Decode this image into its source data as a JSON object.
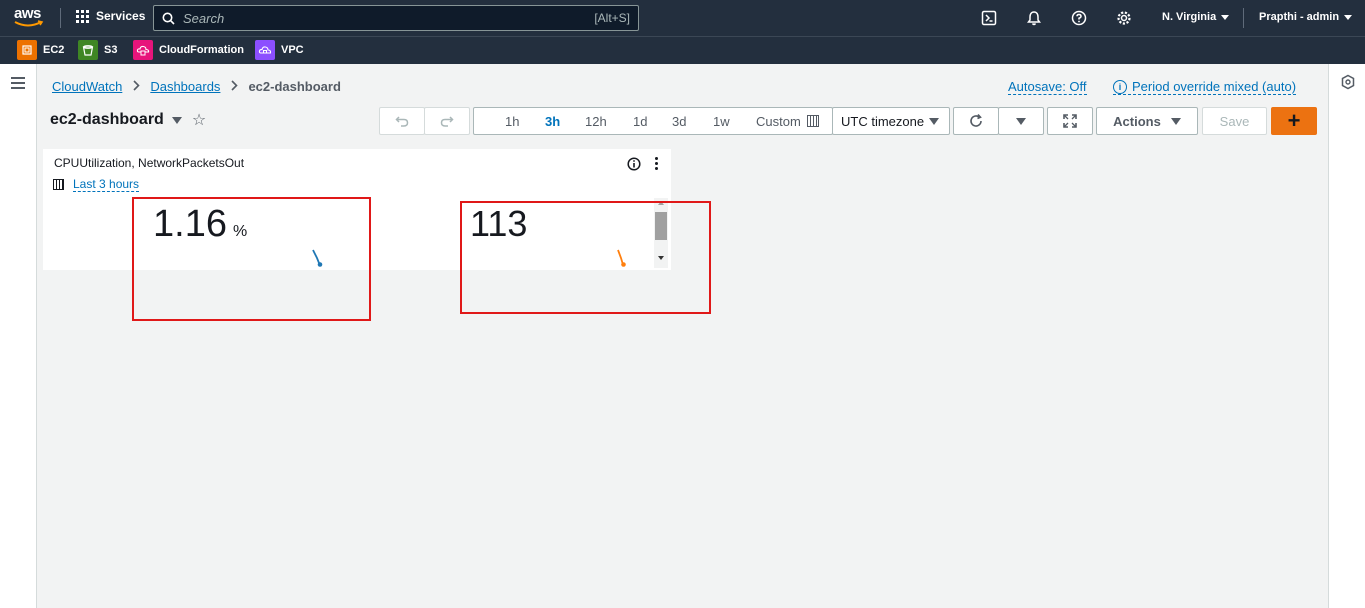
{
  "topnav": {
    "logo_text": "aws",
    "services_label": "Services",
    "search_placeholder": "Search",
    "search_shortcut": "[Alt+S]",
    "region": "N. Virginia",
    "user": "Prapthi - admin"
  },
  "favorites": [
    {
      "label": "EC2",
      "color": "#ed7100"
    },
    {
      "label": "S3",
      "color": "#3f8624"
    },
    {
      "label": "CloudFormation",
      "color": "#e7157b"
    },
    {
      "label": "VPC",
      "color": "#8c4fff"
    }
  ],
  "breadcrumb": {
    "items": [
      "CloudWatch",
      "Dashboards",
      "ec2-dashboard"
    ]
  },
  "header": {
    "autosave": "Autosave: Off",
    "period_override": "Period override mixed (auto)",
    "dashboard_title": "ec2-dashboard"
  },
  "toolbar": {
    "time_ranges": [
      "1h",
      "3h",
      "12h",
      "1d",
      "3d",
      "1w"
    ],
    "selected_range": "3h",
    "custom_label": "Custom",
    "timezone": "UTC timezone",
    "actions_label": "Actions",
    "save_label": "Save",
    "add_label": "+"
  },
  "widget": {
    "title": "CPUUtilization, NetworkPacketsOut",
    "range_label": "Last 3 hours",
    "metrics": [
      {
        "value": "1.16",
        "unit": "%",
        "color": "#1f77b4"
      },
      {
        "value": "113",
        "unit": "",
        "color": "#ff7f0e"
      }
    ]
  },
  "colors": {
    "nav_bg": "#232f3e",
    "link": "#0073bb",
    "primary": "#ec7211",
    "highlight": "#e01818"
  }
}
